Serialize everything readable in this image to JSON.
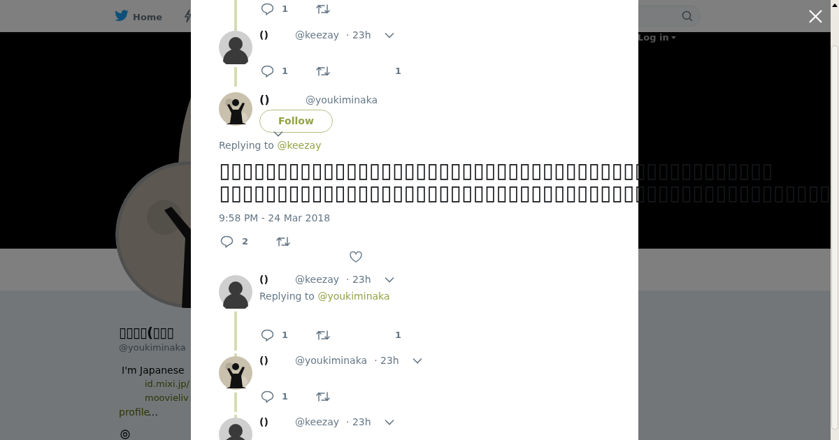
{
  "topbar": {
    "home": "Home",
    "login": "Log in"
  },
  "profile": {
    "name": "▯▯▯▯(▯▯▯",
    "handle": "@youkiminaka",
    "bio": "I'm Japanese",
    "links": [
      "id.mixi.jp/",
      "moovieliv"
    ],
    "more_link": "profile",
    "more_suffix": "…"
  },
  "modal": {
    "previous_actions": {
      "replies": "1",
      "thread": true
    },
    "tweets": [
      {
        "kind": "reply",
        "avatar": {
          "kind": "person"
        },
        "name": "()",
        "handle": "@keezay",
        "time": "· 23h",
        "thread_above": true,
        "thread_below": true,
        "actions": {
          "replies": "1",
          "likes": "1"
        }
      },
      {
        "kind": "main",
        "avatar": {
          "kind": "figure"
        },
        "name": "()",
        "handle": "@youkiminaka",
        "follow": "Follow",
        "replying_prefix": "Replying to",
        "replying_handle": "@keezay",
        "text": "▯▯▯▯▯▯▯▯▯▯▯▯▯▯▯▯▯▯▯▯▯▯▯▯▯▯▯▯▯▯▯▯▯▯▯▯▯▯▯▯▯▯▯▯▯▯▯▯\n▯▯▯▯▯▯▯▯▯▯▯▯▯▯▯▯▯▯▯▯▯▯▯▯▯▯▯▯▯▯▯▯▯▯▯▯▯▯▯▯▯▯▯▯▯▯▯▯▯▯▯▯▯",
        "timestamp": "9:58 PM - 24 Mar 2018",
        "actions": {
          "replies": "2"
        }
      },
      {
        "kind": "reply",
        "avatar": {
          "kind": "person"
        },
        "name": "()",
        "handle": "@keezay",
        "time": "· 23h",
        "replying_prefix": "Replying to",
        "replying_handle": "@youkiminaka",
        "thread_above": false,
        "thread_below": true,
        "actions": {
          "replies": "1",
          "likes": "1"
        }
      },
      {
        "kind": "reply",
        "avatar": {
          "kind": "figure"
        },
        "name": "()",
        "handle": "@youkiminaka",
        "time": "· 23h",
        "thread_above": true,
        "thread_below": true,
        "actions": {
          "replies": "1"
        }
      },
      {
        "kind": "reply",
        "avatar": {
          "kind": "person"
        },
        "name": "()",
        "handle": "@keezay",
        "time": "· 23h",
        "thread_above": true,
        "thread_below": false
      }
    ]
  }
}
